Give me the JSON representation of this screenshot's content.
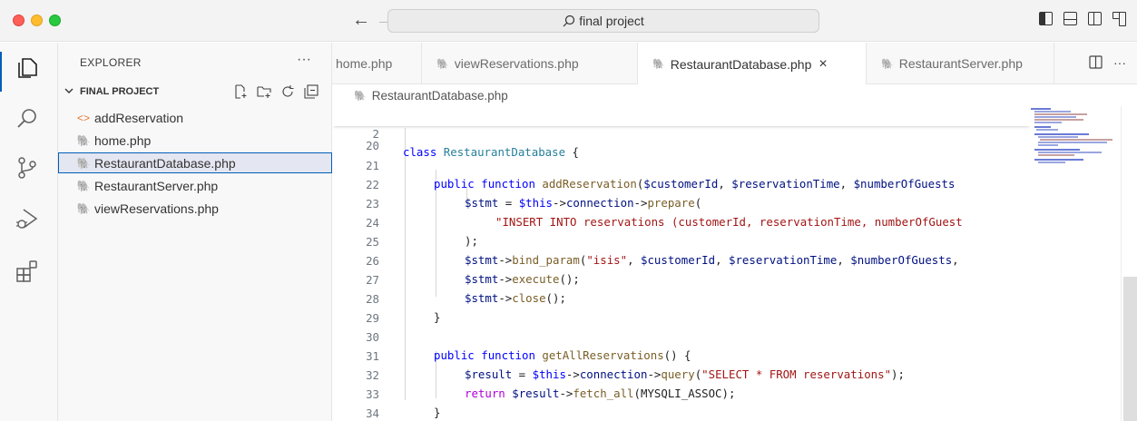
{
  "window": {
    "search_text": "final project",
    "traffic_lights": {
      "close": "#fe5f57",
      "minimize": "#febc2e",
      "maximize": "#28c840"
    }
  },
  "activity_bar": {
    "items": [
      "explorer-icon",
      "search-icon",
      "source-control-icon",
      "run-debug-icon",
      "extensions-icon"
    ],
    "accent": "#005fb8"
  },
  "explorer": {
    "title": "EXPLORER",
    "more": "···",
    "project_name": "FINAL PROJECT",
    "files": [
      {
        "name": "addReservation",
        "icon": "html-icon",
        "selected": false
      },
      {
        "name": "home.php",
        "icon": "php-icon",
        "selected": false
      },
      {
        "name": "RestaurantDatabase.php",
        "icon": "php-icon",
        "selected": true
      },
      {
        "name": "RestaurantServer.php",
        "icon": "php-icon",
        "selected": false
      },
      {
        "name": "viewReservations.php",
        "icon": "php-icon",
        "selected": false
      }
    ]
  },
  "tabs": [
    {
      "label": "home.php",
      "active": false
    },
    {
      "label": "viewReservations.php",
      "active": false
    },
    {
      "label": "RestaurantDatabase.php",
      "active": true,
      "close": "×"
    },
    {
      "label": "RestaurantServer.php",
      "active": false
    }
  ],
  "tab_actions": {
    "more": "···"
  },
  "breadcrumb": {
    "file": "RestaurantDatabase.php"
  },
  "editor": {
    "sticky": {
      "number": "2",
      "text": "class RestaurantDatabase {"
    },
    "partial_line_number": "19",
    "lines": [
      {
        "n": "20"
      },
      {
        "n": "21"
      },
      {
        "n": "22"
      },
      {
        "n": "23"
      },
      {
        "n": "24"
      },
      {
        "n": "25"
      },
      {
        "n": "26"
      },
      {
        "n": "27"
      },
      {
        "n": "28"
      },
      {
        "n": "29"
      },
      {
        "n": "30"
      },
      {
        "n": "31"
      },
      {
        "n": "32"
      },
      {
        "n": "33"
      },
      {
        "n": "34"
      }
    ],
    "code": {
      "l21": [
        "public",
        " ",
        "function",
        " ",
        "addReservation",
        "(",
        "$customerId",
        ", ",
        "$reservationTime",
        ", ",
        "$numberOfGuests"
      ],
      "l22": [
        "$stmt",
        " = ",
        "$this",
        "->",
        "connection",
        "->",
        "prepare",
        "("
      ],
      "l23": [
        "\"INSERT INTO reservations (customerId, reservationTime, numberOfGuest"
      ],
      "l24": [
        ");"
      ],
      "l25": [
        "$stmt",
        "->",
        "bind_param",
        "(",
        "\"isis\"",
        ", ",
        "$customerId",
        ", ",
        "$reservationTime",
        ", ",
        "$numberOfGuests",
        ","
      ],
      "l26": [
        "$stmt",
        "->",
        "execute",
        "();"
      ],
      "l27": [
        "$stmt",
        "->",
        "close",
        "();"
      ],
      "l28": [
        "}"
      ],
      "l30": [
        "public",
        " ",
        "function",
        " ",
        "getAllReservations",
        "() {"
      ],
      "l31": [
        "$result",
        " = ",
        "$this",
        "->",
        "connection",
        "->",
        "query",
        "(",
        "\"SELECT * FROM reservations\"",
        ");"
      ],
      "l32": [
        "return",
        " ",
        "$result",
        "->",
        "fetch_all",
        "(",
        "MYSQLI_ASSOC",
        ");"
      ],
      "l33": [
        "}"
      ],
      "l34": [
        "}"
      ]
    }
  }
}
